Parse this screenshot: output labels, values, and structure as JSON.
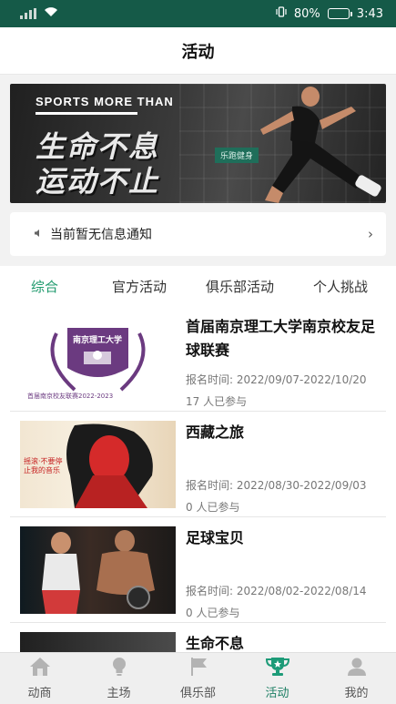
{
  "status_bar": {
    "battery": "80%",
    "time": "3:43",
    "battery_level": 0.8
  },
  "header": {
    "title": "活动"
  },
  "banner": {
    "tagline": "SPORTS MORE THAN",
    "line1": "生命不息",
    "line2": "运动不止",
    "tag": "乐跑健身"
  },
  "notice": {
    "text": "当前暂无信息通知"
  },
  "tabs": [
    {
      "label": "综合",
      "active": true
    },
    {
      "label": "官方活动",
      "active": false
    },
    {
      "label": "俱乐部活动",
      "active": false
    },
    {
      "label": "个人挑战",
      "active": false
    }
  ],
  "activities": [
    {
      "title": "首届南京理工大学南京校友足球联赛",
      "date": "报名时间: 2022/09/07-2022/10/20",
      "count": "17 人已参与",
      "poster_title": "南京理工大学",
      "poster_sub": "首届南京校友联赛2022-2023"
    },
    {
      "title": "西藏之旅",
      "date": "报名时间: 2022/08/30-2022/09/03",
      "count": "0 人已参与",
      "poster_title": "摇滚·不要停止我的音乐"
    },
    {
      "title": "足球宝贝",
      "date": "报名时间: 2022/08/02-2022/08/14",
      "count": "0 人已参与"
    },
    {
      "title": "生命不息",
      "date": "",
      "count": ""
    }
  ],
  "tabbar": [
    {
      "label": "动商",
      "icon": "home-icon",
      "active": false
    },
    {
      "label": "主场",
      "icon": "lightbulb-icon",
      "active": false
    },
    {
      "label": "俱乐部",
      "icon": "flag-icon",
      "active": false
    },
    {
      "label": "活动",
      "icon": "trophy-icon",
      "active": true
    },
    {
      "label": "我的",
      "icon": "user-icon",
      "active": false
    }
  ],
  "colors": {
    "status_bar": "#155a48",
    "accent": "#1f9a6d",
    "tab_active": "#1c7e63"
  }
}
